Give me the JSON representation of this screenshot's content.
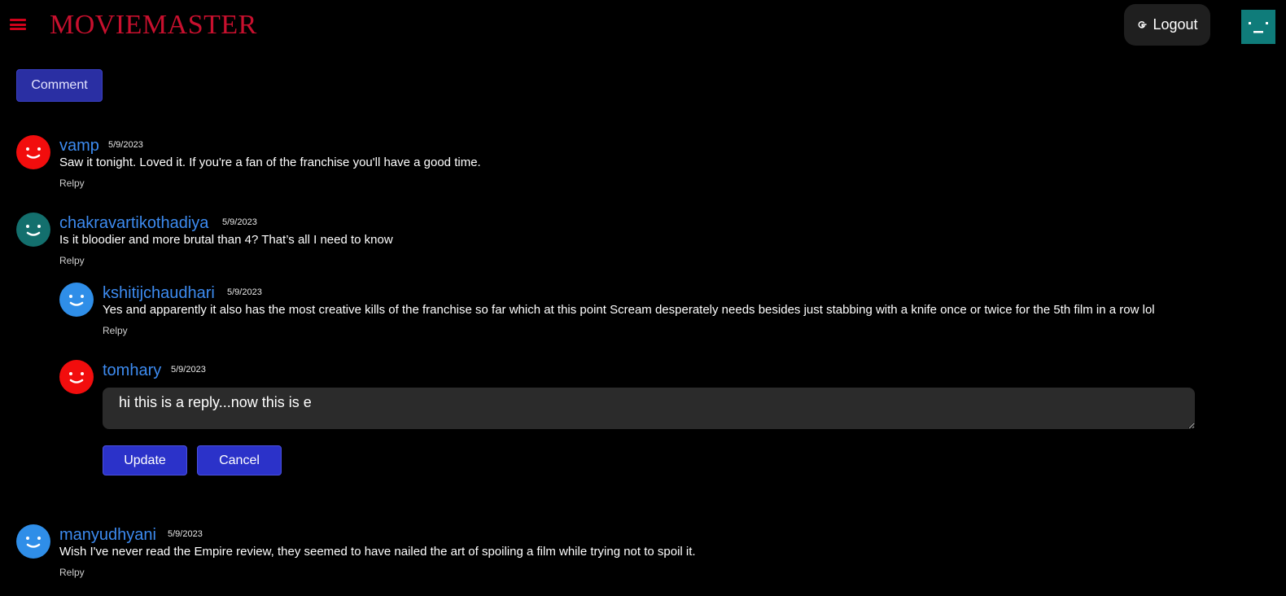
{
  "header": {
    "logo": "MOVIEMASTER",
    "logout_label": "Logout",
    "brand_color": "#c8102e"
  },
  "comment_button_label": "Comment",
  "comments": [
    {
      "user": "vamp",
      "date": "5/9/2023",
      "text": "Saw it tonight. Loved it. If you're a fan of the franchise you'll have a good time.",
      "reply_label": "Relpy",
      "avatar_color": "#f20d0d"
    },
    {
      "user": "chakravartikothadiya",
      "date": "5/9/2023",
      "text": "Is it bloodier and more brutal than 4? That’s all I need to know",
      "reply_label": "Relpy",
      "avatar_color": "#136f6d"
    },
    {
      "user": "kshitijchaudhari",
      "date": "5/9/2023",
      "text": "Yes and apparently it also has the most creative kills of the franchise so far which at this point Scream desperately needs besides just stabbing with a knife once or twice for the 5th film in a row lol",
      "reply_label": "Relpy",
      "avatar_color": "#2f8ee8"
    },
    {
      "user": "tomhary",
      "date": "5/9/2023",
      "edit_value": "hi this is a reply...now this is e",
      "update_label": "Update",
      "cancel_label": "Cancel",
      "avatar_color": "#f20d0d"
    },
    {
      "user": "manyudhyani",
      "date": "5/9/2023",
      "text": "Wish I've never read the Empire review, they seemed to have nailed the art of spoiling a film while trying not to spoil it.",
      "reply_label": "Relpy",
      "avatar_color": "#2f8ee8"
    }
  ]
}
